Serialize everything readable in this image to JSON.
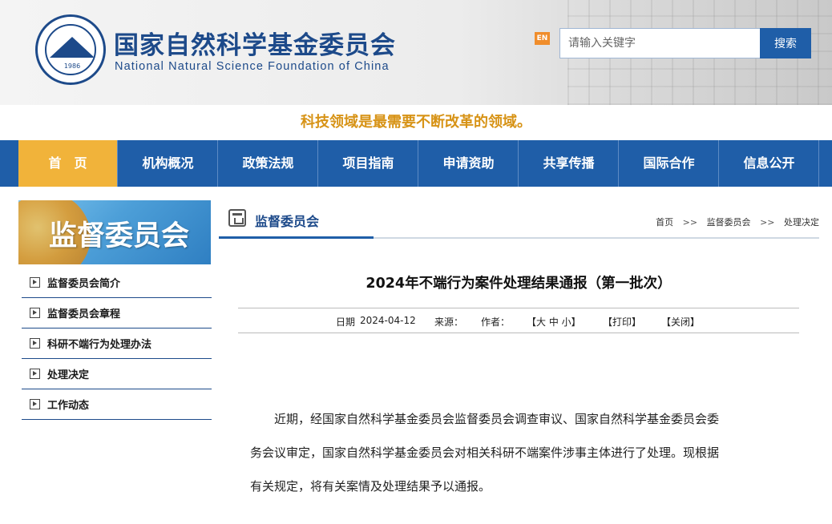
{
  "header": {
    "org_name_cn": "国家自然科学基金委员会",
    "org_name_en": "National Natural Science Foundation of China",
    "logo_year": "1986",
    "lang_badge": "EN",
    "search": {
      "placeholder": "请输入关键字",
      "button_label": "搜索"
    }
  },
  "slogan": "科技领域是最需要不断改革的领域。",
  "nav": {
    "items": [
      {
        "label": "首　页",
        "active": true
      },
      {
        "label": "机构概况"
      },
      {
        "label": "政策法规"
      },
      {
        "label": "项目指南"
      },
      {
        "label": "申请资助"
      },
      {
        "label": "共享传播"
      },
      {
        "label": "国际合作"
      },
      {
        "label": "信息公开"
      }
    ]
  },
  "sidebar": {
    "banner_title": "监督委员会",
    "items": [
      {
        "label": "监督委员会简介"
      },
      {
        "label": "监督委员会章程"
      },
      {
        "label": "科研不端行为处理办法"
      },
      {
        "label": "处理决定"
      },
      {
        "label": "工作动态"
      }
    ]
  },
  "main": {
    "section_title": "监督委员会",
    "breadcrumb": [
      "首页",
      "监督委员会",
      "处理决定"
    ],
    "breadcrumb_sep": ">>",
    "article": {
      "title": "2024年不端行为案件处理结果通报（第一批次）",
      "date_label": "日期",
      "date": "2024-04-12",
      "source_label": "来源：",
      "author_label": "作者：",
      "font_size_ctrl": "【大 中 小】",
      "print_label": "【打印】",
      "close_label": "【关闭】",
      "paragraph_lines": [
        "　　近期，经国家自然科学基金委员会监督委员会调查审议、国家自然科学基金委员会委",
        "务会议审定，国家自然科学基金委员会对相关科研不端案件涉事主体进行了处理。现根据",
        "有关规定，将有关案情及处理结果予以通报。"
      ]
    }
  }
}
